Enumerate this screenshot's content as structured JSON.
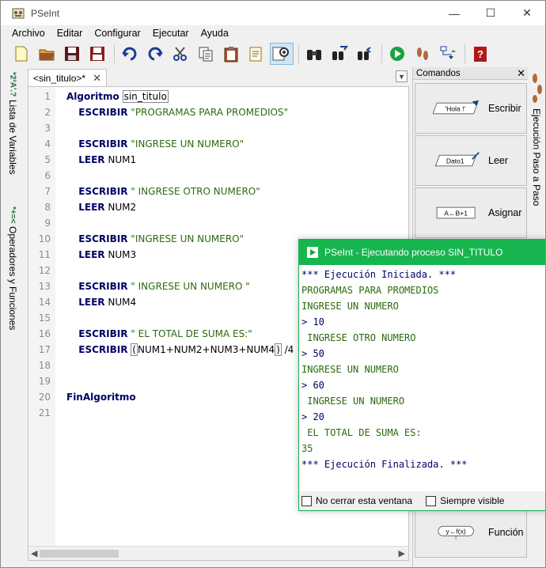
{
  "window": {
    "title": "PSeInt"
  },
  "menu": [
    "Archivo",
    "Editar",
    "Configurar",
    "Ejecutar",
    "Ayuda"
  ],
  "toolbar": [
    {
      "name": "new-file-icon"
    },
    {
      "name": "open-folder-icon"
    },
    {
      "name": "save-icon"
    },
    {
      "name": "save-as-icon"
    },
    {
      "name": "undo-icon"
    },
    {
      "name": "redo-icon"
    },
    {
      "name": "cut-icon"
    },
    {
      "name": "copy-icon"
    },
    {
      "name": "paste-icon"
    },
    {
      "name": "edit-icon"
    },
    {
      "name": "search-icon"
    },
    {
      "name": "binoculars-icon"
    },
    {
      "name": "find-next-icon"
    },
    {
      "name": "replace-icon"
    },
    {
      "name": "run-icon"
    },
    {
      "name": "step-icon"
    },
    {
      "name": "flowchart-icon"
    },
    {
      "name": "help-icon"
    }
  ],
  "left_tabs": {
    "variables": "Lista de Variables",
    "operators": "Operadores y Funciones",
    "variables_icon": "*2²A'.? ",
    "operators_icon": "*+=<"
  },
  "editor": {
    "tab_label": "<sin_titulo>*",
    "lines": [
      {
        "n": "1"
      },
      {
        "n": "2"
      },
      {
        "n": "3"
      },
      {
        "n": "4"
      },
      {
        "n": "5"
      },
      {
        "n": "6"
      },
      {
        "n": "7"
      },
      {
        "n": "8"
      },
      {
        "n": "9"
      },
      {
        "n": "10"
      },
      {
        "n": "11"
      },
      {
        "n": "12"
      },
      {
        "n": "13"
      },
      {
        "n": "14"
      },
      {
        "n": "15"
      },
      {
        "n": "16"
      },
      {
        "n": "17"
      },
      {
        "n": "18"
      },
      {
        "n": "19"
      },
      {
        "n": "20"
      },
      {
        "n": "21"
      }
    ],
    "code": {
      "l1_kw": "Algoritmo",
      "l1_name": "sin_titulo",
      "l2_kw": "ESCRIBIR",
      "l2_str": "\"PROGRAMAS PARA PROMEDIOS\"",
      "l4_kw": "ESCRIBIR",
      "l4_str": "\"INGRESE UN NUMERO\"",
      "l5_kw": "LEER",
      "l5_var": "NUM1",
      "l7_kw": "ESCRIBIR",
      "l7_str": "\" INGRESE OTRO NUMERO\"",
      "l8_kw": "LEER",
      "l8_var": "NUM2",
      "l10_kw": "ESCRIBIR",
      "l10_str": "\"INGRESE UN NUMERO\"",
      "l11_kw": "LEER",
      "l11_var": "NUM3",
      "l13_kw": "ESCRIBIR",
      "l13_str": "\" INGRESE UN NUMERO \"",
      "l14_kw": "LEER",
      "l14_var": "NUM4",
      "l16_kw": "ESCRIBIR",
      "l16_str": "\" EL TOTAL DE SUMA ES:\"",
      "l17_kw": "ESCRIBIR",
      "l17_paren_open": "(",
      "l17_expr": "NUM1+NUM2+NUM3+NUM4",
      "l17_paren_close": ")",
      "l17_tail": " /4",
      "l20_kw": "FinAlgoritmo"
    }
  },
  "commands": {
    "title": "Comandos",
    "items": [
      {
        "label": "Escribir",
        "icon_text": "'Hola !'"
      },
      {
        "label": "Leer",
        "icon_text": "Dato1"
      },
      {
        "label": "Asignar",
        "icon_text": "A←B+1"
      },
      {
        "label": "Función",
        "icon_text": "y←f(x)"
      }
    ]
  },
  "right_tab": {
    "label": "Ejecución Paso a Paso"
  },
  "run_window": {
    "title": "PSeInt - Ejecutando proceso SIN_TITULO",
    "output": [
      {
        "text": "*** Ejecución Iniciada. ***",
        "kind": "sys"
      },
      {
        "text": "PROGRAMAS PARA PROMEDIOS",
        "kind": "text"
      },
      {
        "text": "INGRESE UN NUMERO",
        "kind": "text"
      },
      {
        "text": "> 10",
        "kind": "in"
      },
      {
        "text": " INGRESE OTRO NUMERO",
        "kind": "text"
      },
      {
        "text": "> 50",
        "kind": "in"
      },
      {
        "text": "INGRESE UN NUMERO",
        "kind": "text"
      },
      {
        "text": "> 60",
        "kind": "in"
      },
      {
        "text": " INGRESE UN NUMERO",
        "kind": "text"
      },
      {
        "text": "> 20",
        "kind": "in"
      },
      {
        "text": " EL TOTAL DE SUMA ES:",
        "kind": "text"
      },
      {
        "text": "35",
        "kind": "text"
      },
      {
        "text": "*** Ejecución Finalizada. ***",
        "kind": "sys"
      }
    ],
    "keep_open_label": "No cerrar esta ventana",
    "always_visible_label": "Siempre visible"
  },
  "colors": {
    "keyword": "#000066",
    "string": "#2c6b0f",
    "run_title": "#17b54f"
  }
}
